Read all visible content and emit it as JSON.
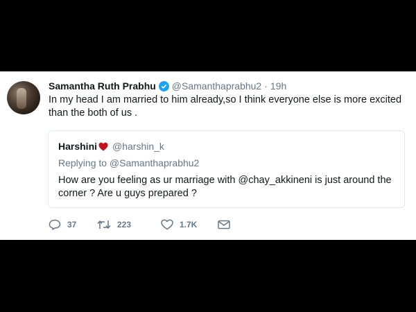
{
  "tweet": {
    "display_name": "Samantha Ruth Prabhu",
    "handle": "@Samanthaprabhu2",
    "separator": "·",
    "time": "19h",
    "text": "In my head I am married to him already,so I think everyone else is more excited than the both of us ."
  },
  "quote": {
    "display_name": "Harshini",
    "handle": "@harshin_k",
    "replying_to": "Replying to @Samanthaprabhu2",
    "text": "How are you feeling as ur marriage with @chay_akkineni is just around the corner ? Are u guys prepared ?"
  },
  "actions": {
    "replies": "37",
    "retweets": "223",
    "likes": "1.7K"
  },
  "icons": {
    "reply": "reply-icon",
    "retweet": "retweet-icon",
    "like": "heart-icon",
    "message": "envelope-icon",
    "verified": "verified-badge-icon",
    "emoji": "red-heart-emoji-icon"
  },
  "colors": {
    "verified": "#1da1f2",
    "secondary_text": "#657786",
    "border": "#e1e8ed",
    "heart_emoji": "#c0121d"
  }
}
